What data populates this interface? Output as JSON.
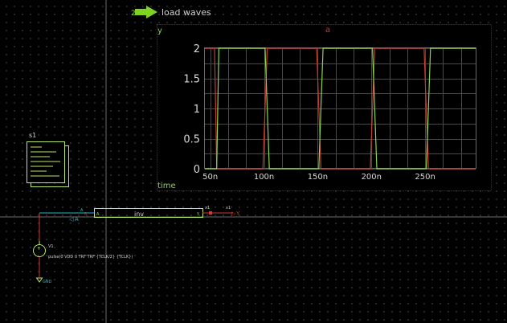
{
  "toolbar": {
    "load_waves_label": "load waves",
    "load_waves_badge": "2"
  },
  "graph": {
    "y_label": "y",
    "a_label": "a",
    "time_label": "time",
    "y_ticks": [
      "2",
      "1.5",
      "1",
      "0.5",
      "0"
    ],
    "x_ticks": [
      "50n",
      "100n",
      "150n",
      "200n",
      "250n"
    ]
  },
  "chart_data": {
    "type": "line",
    "xlabel": "time",
    "xlim": [
      45,
      297
    ],
    "ylim": [
      0,
      2
    ],
    "series": [
      {
        "name": "a",
        "color": "#c93b2e",
        "x": [
          45,
          54,
          55,
          56,
          99,
          101,
          103,
          149,
          151,
          153,
          199,
          201,
          203,
          249,
          251,
          253,
          297
        ],
        "y": [
          2,
          2,
          1,
          0,
          0,
          1,
          2,
          2,
          1,
          0,
          0,
          1,
          2,
          2,
          1,
          0,
          0
        ]
      },
      {
        "name": "y",
        "color": "#8bd54a",
        "x": [
          45,
          56,
          57,
          58,
          101,
          103,
          105,
          151,
          153,
          155,
          201,
          203,
          205,
          251,
          253,
          255,
          297
        ],
        "y": [
          0,
          0,
          1,
          2,
          2,
          1,
          0,
          0,
          1,
          2,
          2,
          1,
          0,
          0,
          1,
          2,
          2
        ]
      }
    ]
  },
  "schematic": {
    "symbol_s1_label": "s1",
    "inv_label": "inv",
    "pin_a_left": "A",
    "pin_a_inner": "A",
    "pin_y": "Y",
    "net_a": "A",
    "net_y": "Y",
    "net_x1_top1": "x1",
    "net_x1_top2": "x1",
    "pin_p": "p",
    "source_name": "V1",
    "source_value": "pulse(0 VDD 0 TRF TRF {TCLK/2} {TCLK})",
    "gnd_label": "GND"
  },
  "colors": {
    "accent": "#8bd54a",
    "wire": "#c93b2e",
    "net": "#27b7c9",
    "grid": "#555555"
  }
}
